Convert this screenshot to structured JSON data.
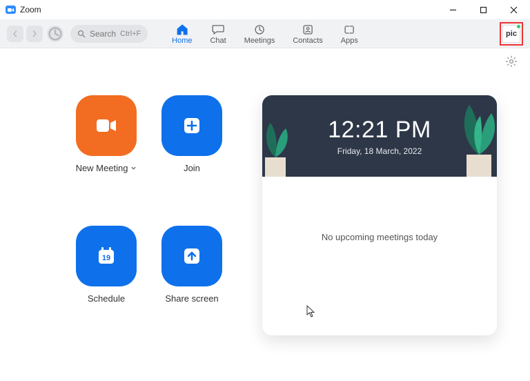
{
  "window": {
    "title": "Zoom"
  },
  "search": {
    "label": "Search",
    "shortcut": "Ctrl+F"
  },
  "tabs": {
    "home": "Home",
    "chat": "Chat",
    "meetings": "Meetings",
    "contacts": "Contacts",
    "apps": "Apps"
  },
  "avatar": {
    "text": "pic"
  },
  "actions": {
    "new_meeting": "New Meeting",
    "join": "Join",
    "schedule": "Schedule",
    "schedule_day": "19",
    "share": "Share screen"
  },
  "clock": {
    "time": "12:21 PM",
    "date": "Friday, 18 March, 2022"
  },
  "upcoming": "No upcoming meetings today"
}
